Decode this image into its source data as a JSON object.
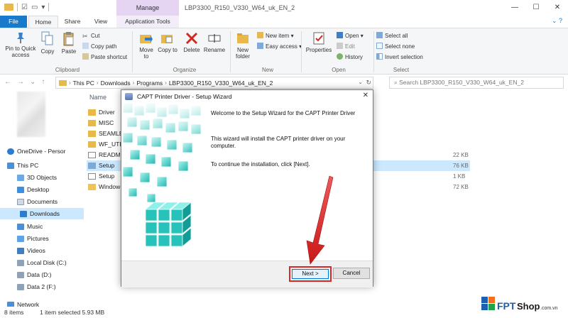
{
  "window": {
    "title": "LBP3300_R150_V330_W64_uk_EN_2",
    "minimize": "—",
    "maximize": "☐",
    "close": "✕"
  },
  "tabs": {
    "file": "File",
    "home": "Home",
    "share": "Share",
    "view": "View",
    "manage": "Manage",
    "app_tools": "Application Tools"
  },
  "ribbon": {
    "clipboard": {
      "label": "Clipboard",
      "pin": "Pin to Quick access",
      "copy": "Copy",
      "paste": "Paste",
      "cut": "Cut",
      "copy_path": "Copy path",
      "paste_shortcut": "Paste shortcut"
    },
    "organize": {
      "label": "Organize",
      "move_to": "Move to",
      "copy_to": "Copy to",
      "delete": "Delete",
      "rename": "Rename"
    },
    "new": {
      "label": "New",
      "new_folder": "New folder",
      "new_item": "New item",
      "easy_access": "Easy access"
    },
    "open": {
      "label": "Open",
      "properties": "Properties",
      "open": "Open",
      "edit": "Edit",
      "history": "History"
    },
    "select": {
      "label": "Select",
      "select_all": "Select all",
      "select_none": "Select none",
      "invert": "Invert selection"
    }
  },
  "address": {
    "crumbs": [
      "This PC",
      "Downloads",
      "Programs",
      "LBP3300_R150_V330_W64_uk_EN_2"
    ],
    "search_placeholder": "Search LBP3300_R150_V330_W64_uk_EN_2"
  },
  "nav_pane": {
    "onedrive": "OneDrive - Persor",
    "this_pc": "This PC",
    "items": [
      "3D Objects",
      "Desktop",
      "Documents",
      "Downloads",
      "Music",
      "Pictures",
      "Videos",
      "Local Disk (C:)",
      "Data (D:)",
      "Data 2 (F:)"
    ],
    "network": "Network"
  },
  "file_list": {
    "column_name": "Name",
    "files": [
      {
        "name": "Driver",
        "size": ""
      },
      {
        "name": "MISC",
        "size": ""
      },
      {
        "name": "SEAMLE",
        "size": ""
      },
      {
        "name": "WF_UTIL",
        "size": ""
      },
      {
        "name": "READMI",
        "size": "22 KB"
      },
      {
        "name": "Setup",
        "size": "76 KB"
      },
      {
        "name": "Setup",
        "size": "1 KB"
      },
      {
        "name": "Window",
        "size": "72 KB"
      }
    ]
  },
  "status": {
    "items": "8 items",
    "selected": "1 item selected  5.93 MB"
  },
  "dialog": {
    "title": "CAPT Printer Driver - Setup Wizard",
    "close": "✕",
    "welcome": "Welcome to the Setup Wizard for the CAPT Printer Driver",
    "body": "This wizard will install the CAPT printer driver on your computer.",
    "instruction": "To continue the installation, click [Next].",
    "next": "Next >",
    "cancel": "Cancel"
  },
  "watermark": {
    "brand": "FPT",
    "suffix": "Shop",
    "domain": ".com.vn"
  },
  "colors": {
    "file_tab": "#1979ca",
    "manage_tab": "#e5d5f3",
    "selection": "#cce8ff",
    "highlight_box": "#d42a2a",
    "fpt_orange": "#f37021"
  }
}
